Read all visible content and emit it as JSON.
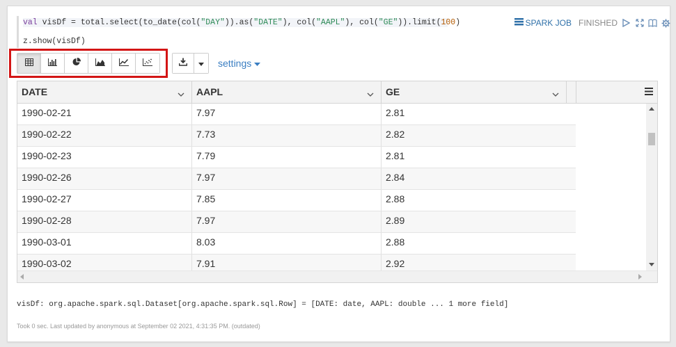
{
  "editor": {
    "line1": {
      "t1": "val",
      "t2": " visDf = total.select(to_date(col(",
      "t3": "\"DAY\"",
      "t4": ")).as(",
      "t5": "\"DATE\"",
      "t6": "), col(",
      "t7": "\"AAPL\"",
      "t8": "), col(",
      "t9": "\"GE\"",
      "t10": ")).limit(",
      "t11": "100",
      "t12": ")"
    },
    "line2": "z.show(visDf)"
  },
  "controls": {
    "spark_job_label": "SPARK JOB",
    "status": "FINISHED",
    "icons": [
      "play-icon",
      "expand-icon",
      "book-icon",
      "gear-icon"
    ]
  },
  "visualization": {
    "buttons": [
      {
        "name": "table-view-button",
        "icon": "table-icon",
        "active": true
      },
      {
        "name": "bar-chart-button",
        "icon": "bar-chart-icon",
        "active": false
      },
      {
        "name": "pie-chart-button",
        "icon": "pie-chart-icon",
        "active": false
      },
      {
        "name": "area-chart-button",
        "icon": "area-chart-icon",
        "active": false
      },
      {
        "name": "line-chart-button",
        "icon": "line-chart-icon",
        "active": false
      },
      {
        "name": "scatter-chart-button",
        "icon": "scatter-chart-icon",
        "active": false
      }
    ],
    "download_icon": "download-icon",
    "settings_label": "settings"
  },
  "table": {
    "columns": [
      "DATE",
      "AAPL",
      "GE"
    ],
    "rows": [
      [
        "1990-02-21",
        "7.97",
        "2.81"
      ],
      [
        "1990-02-22",
        "7.73",
        "2.82"
      ],
      [
        "1990-02-23",
        "7.79",
        "2.81"
      ],
      [
        "1990-02-26",
        "7.97",
        "2.84"
      ],
      [
        "1990-02-27",
        "7.85",
        "2.88"
      ],
      [
        "1990-02-28",
        "7.97",
        "2.89"
      ],
      [
        "1990-03-01",
        "8.03",
        "2.88"
      ],
      [
        "1990-03-02",
        "7.91",
        "2.92"
      ]
    ]
  },
  "result_text": "visDf: org.apache.spark.sql.Dataset[org.apache.spark.sql.Row] = [DATE: date, AAPL: double ... 1 more field]",
  "footer": "Took 0 sec. Last updated by anonymous at September 02 2021, 4:31:35 PM. (outdated)",
  "colors": {
    "highlight": "#d31515",
    "link": "#3a7ec2",
    "status": "#888888"
  }
}
